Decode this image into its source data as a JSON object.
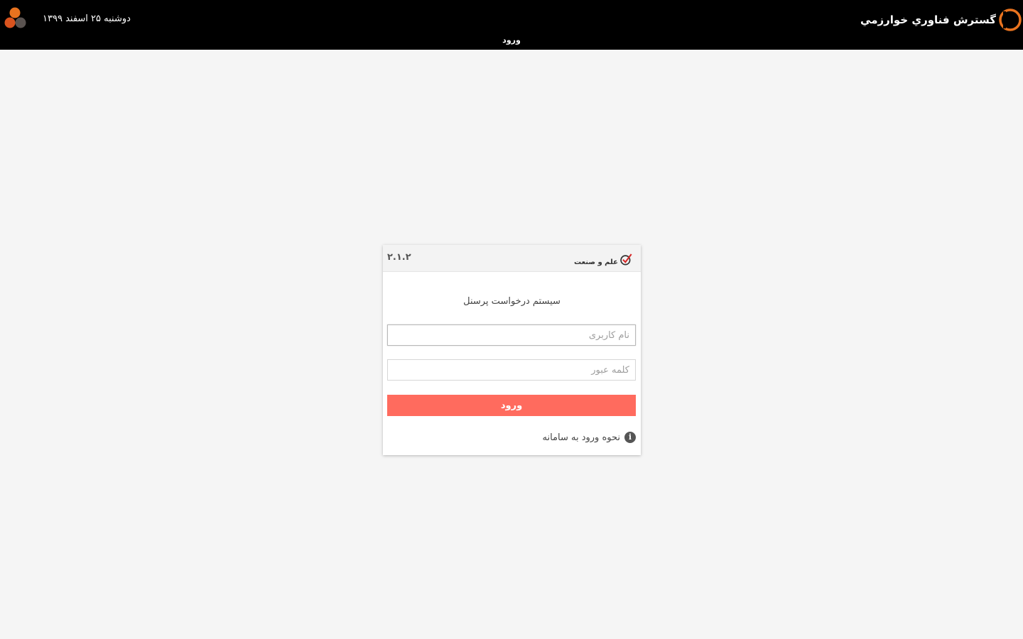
{
  "header": {
    "brand_name": "گسترش فناوري خوارزمي",
    "date": "دوشنبه ۲۵ اسفند ۱۳۹۹",
    "nav_title": "ورود"
  },
  "login": {
    "version": "۲.۱.۲",
    "org_name": "علم و صنعت",
    "title": "سیستم درخواست پرسنل",
    "username_placeholder": "نام کاربری",
    "password_placeholder": "کلمه عبور",
    "submit_label": "ورود",
    "help_label": "نحوه ورود به سامانه"
  },
  "colors": {
    "topbar": "#000000",
    "accent": "#ff6b5e",
    "logo_orange": "#e8731f"
  },
  "icons": {
    "brand": "play-circle-icon",
    "user": "circles-logo-icon",
    "org": "checkmark-circle-icon",
    "help": "info-icon"
  }
}
